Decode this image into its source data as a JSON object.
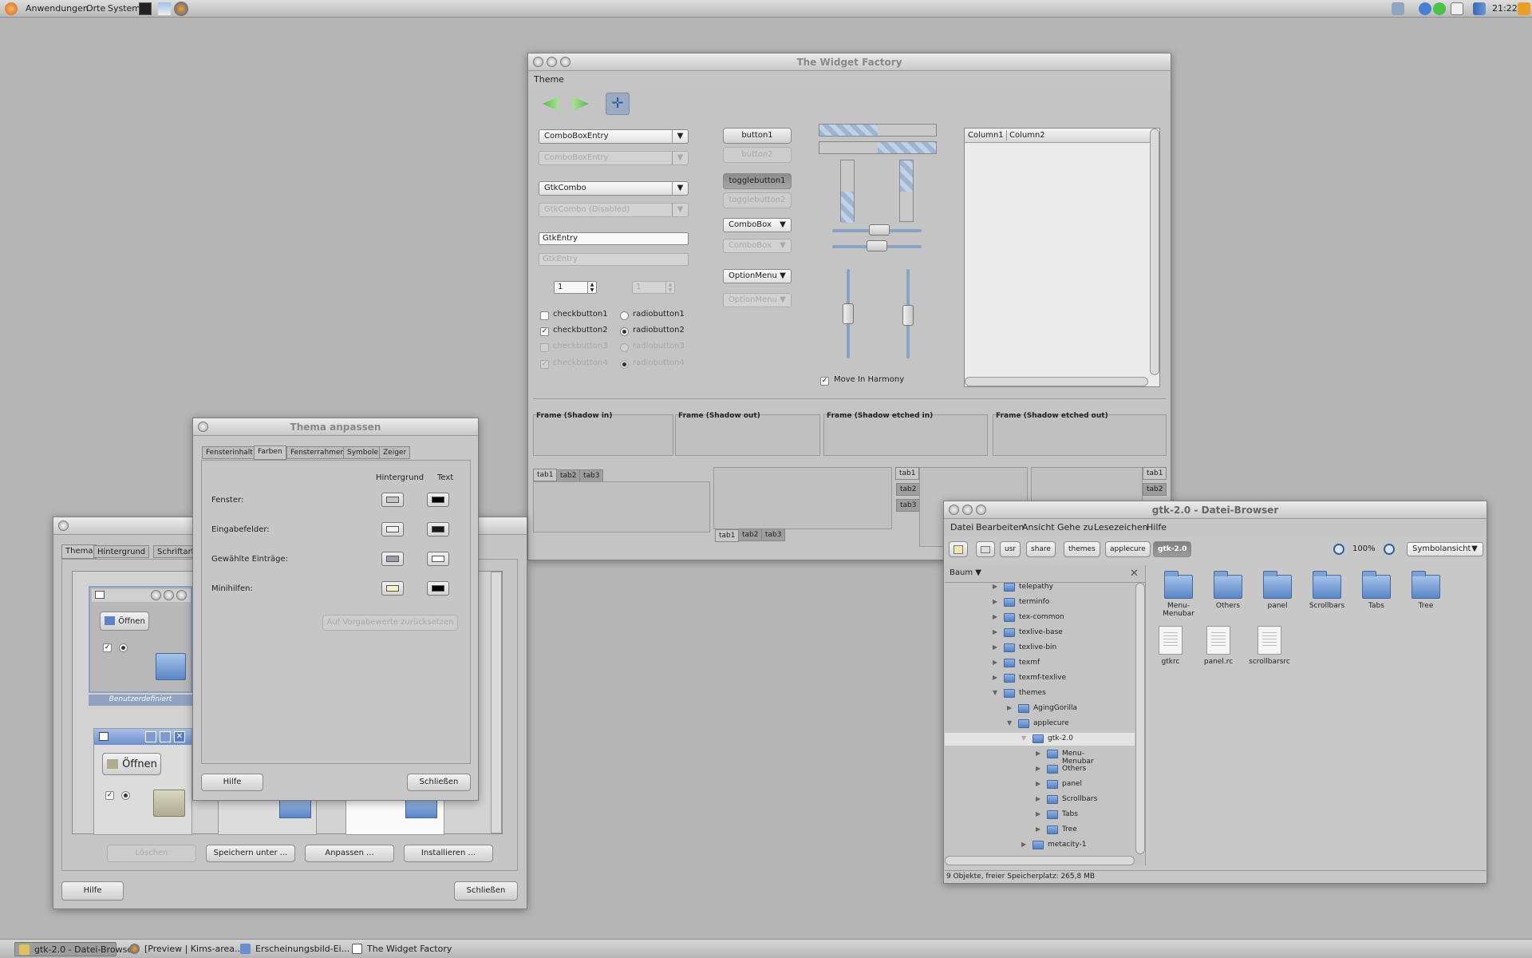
{
  "topbar": {
    "menu_apps": "Anwendungen",
    "menu_places": "Orte",
    "menu_system": "System",
    "clock": "21:22"
  },
  "taskbar": {
    "items": [
      {
        "label": "gtk-2.0 - Datei-Browser"
      },
      {
        "label": "[Preview | Kims-area...."
      },
      {
        "label": "Erscheinungsbild-Ei..."
      },
      {
        "label": "The Widget Factory"
      }
    ]
  },
  "widget_factory": {
    "title": "The Widget Factory",
    "menu_theme": "Theme",
    "combo_entry": "ComboBoxEntry",
    "combo_entry_dis": "ComboBoxEntry",
    "gtkcombo": "GtkCombo",
    "gtkcombo_dis": "GtkCombo (Disabled)",
    "gtkentry": "GtkEntry",
    "gtkentry_dis": "GtkEntry",
    "spin1": "1",
    "spin2": "1",
    "checkbuttons": [
      "checkbutton1",
      "checkbutton2",
      "checkbutton3",
      "checkbutton4"
    ],
    "radiobuttons": [
      "radiobutton1",
      "radiobutton2",
      "radiobutton3",
      "radiobutton4"
    ],
    "button1": "button1",
    "button2": "button2",
    "togglebutton1": "togglebutton1",
    "togglebutton2": "togglebutton2",
    "combobox": "ComboBox",
    "combobox_dis": "ComboBox",
    "optionmenu": "OptionMenu",
    "optionmenu_dis": "OptionMenu",
    "move_in_harmony": "Move In Harmony",
    "column1": "Column1",
    "column2": "Column2",
    "frames": [
      "Frame (Shadow in)",
      "Frame (Shadow out)",
      "Frame (Shadow etched in)",
      "Frame (Shadow etched out)"
    ],
    "tabs": [
      "tab1",
      "tab2",
      "tab3"
    ]
  },
  "appearance_bg": {
    "tabs": [
      "Thema",
      "Hintergrund",
      "Schriftarten"
    ],
    "open_label": "Öffnen",
    "custom_label": "Benutzerdefiniert",
    "btn_delete": "Löschen",
    "btn_save_as": "Speichern unter ...",
    "btn_customize": "Anpassen ...",
    "btn_install": "Installieren ...",
    "btn_help": "Hilfe",
    "btn_close": "Schließen"
  },
  "theme_dialog": {
    "title": "Thema anpassen",
    "tabs": [
      "Fensterinhalt",
      "Farben",
      "Fensterrahmen",
      "Symbole",
      "Zeiger"
    ],
    "col_bg": "Hintergrund",
    "col_text": "Text",
    "rows": [
      "Fenster:",
      "Eingabefelder:",
      "Gewählte Einträge:",
      "Minihilfen:"
    ],
    "reset": "Auf Vorgabewerte zurücksetzen",
    "btn_help": "Hilfe",
    "btn_close": "Schließen"
  },
  "file_browser": {
    "title": "gtk-2.0 - Datei-Browser",
    "menu": [
      "Datei",
      "Bearbeiten",
      "Ansicht",
      "Gehe zu",
      "Lesezeichen",
      "Hilfe"
    ],
    "crumbs": [
      "usr",
      "share",
      "themes",
      "applecure",
      "gtk-2.0"
    ],
    "zoom": "100%",
    "view": "Symbolansicht",
    "sidebar_mode": "Baum",
    "tree": [
      {
        "label": "telepathy"
      },
      {
        "label": "terminfo"
      },
      {
        "label": "tex-common"
      },
      {
        "label": "texlive-base"
      },
      {
        "label": "texlive-bin"
      },
      {
        "label": "texmf"
      },
      {
        "label": "texmf-texlive"
      },
      {
        "label": "themes"
      },
      {
        "label": "AgingGorilla"
      },
      {
        "label": "applecure"
      },
      {
        "label": "gtk-2.0"
      },
      {
        "label": "Menu-Menubar"
      },
      {
        "label": "Others"
      },
      {
        "label": "panel"
      },
      {
        "label": "Scrollbars"
      },
      {
        "label": "Tabs"
      },
      {
        "label": "Tree"
      },
      {
        "label": "metacity-1"
      }
    ],
    "folders": [
      "Menu-Menubar",
      "Others",
      "panel",
      "Scrollbars",
      "Tabs",
      "Tree"
    ],
    "files": [
      "gtkrc",
      "panel.rc",
      "scrollbarsrc"
    ],
    "status": "9 Objekte, freier Speicherplatz: 265,8 MB"
  }
}
